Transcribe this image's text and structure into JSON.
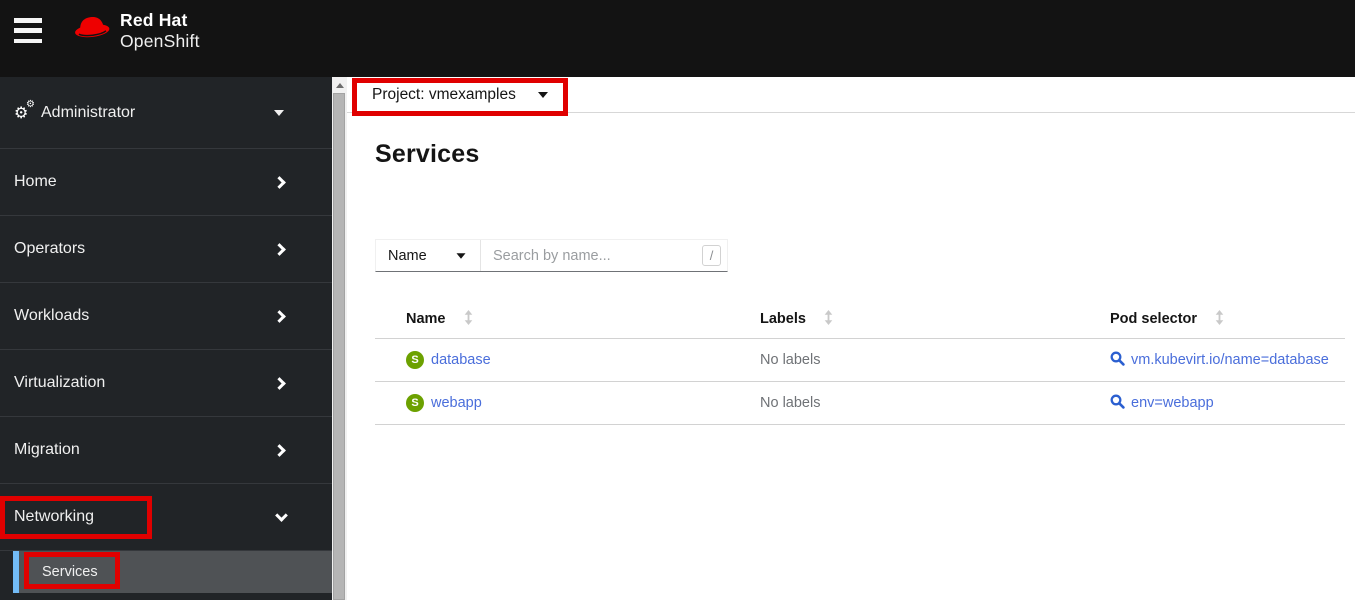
{
  "masthead": {
    "brand_line1": "Red Hat",
    "brand_line2": "OpenShift"
  },
  "sidebar": {
    "perspective": {
      "label": "Administrator"
    },
    "items": [
      {
        "label": "Home",
        "state": "collapsed"
      },
      {
        "label": "Operators",
        "state": "collapsed"
      },
      {
        "label": "Workloads",
        "state": "collapsed"
      },
      {
        "label": "Virtualization",
        "state": "collapsed"
      },
      {
        "label": "Migration",
        "state": "collapsed"
      },
      {
        "label": "Networking",
        "state": "expanded"
      }
    ],
    "subitems": [
      {
        "label": "Services",
        "selected": true
      }
    ]
  },
  "project_selector": {
    "label": "Project: vmexamples"
  },
  "page": {
    "title": "Services"
  },
  "toolbar": {
    "filter_dropdown_label": "Name",
    "search_placeholder": "Search by name...",
    "search_shortcut": "/"
  },
  "table": {
    "columns": [
      "Name",
      "Labels",
      "Pod selector"
    ],
    "rows": [
      {
        "badge": "S",
        "name": "database",
        "labels": "No labels",
        "pod_selector": "vm.kubevirt.io/name=database"
      },
      {
        "badge": "S",
        "name": "webapp",
        "labels": "No labels",
        "pod_selector": "env=webapp"
      }
    ]
  },
  "icons": {
    "menu": "hamburger",
    "brand": "red-fedora-hat",
    "perspective": "cogs",
    "nav_collapsed": "chevron-right",
    "nav_expanded": "chevron-down",
    "dropdown": "caret-down",
    "sort": "arrows-vertical",
    "pod_selector": "search-magnifier",
    "scrollbar": "triangle-up"
  },
  "colors": {
    "brand_red": "#ee0000",
    "masthead_bg": "#131313",
    "sidebar_bg": "#212427",
    "selected_item_bg": "#4f5255",
    "selected_indicator": "#73bcf7",
    "link_blue": "#4a6edb",
    "service_badge_green": "#6ca100",
    "annotation_red": "#e00000"
  }
}
